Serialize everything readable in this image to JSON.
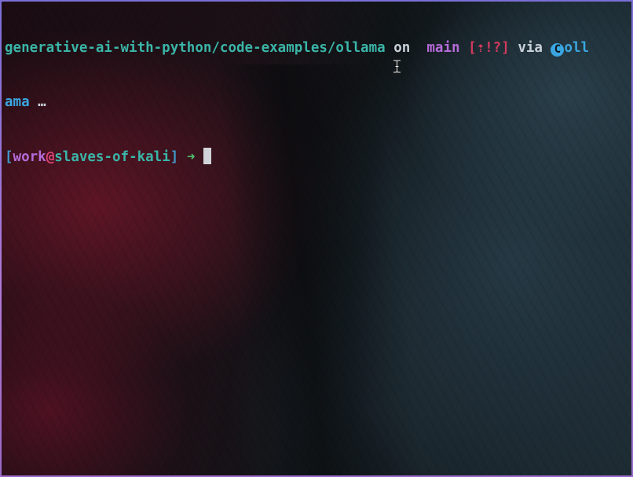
{
  "prompt_line1": {
    "path": "generative-ai-with-python/code-examples/ollama",
    "on": "on",
    "branch_icon": "",
    "branch": "main",
    "git_status": "[⇡!?]",
    "via": "via",
    "env_icon": "C",
    "env_name_a": "oll",
    "env_name_b": "ama",
    "ellipsis": "…"
  },
  "prompt_line2": {
    "open_bracket": "[",
    "user": "work",
    "at": "@",
    "host": "slaves-of-kali",
    "close_bracket": "]",
    "arrow": "➜"
  },
  "icons": {
    "branch": "git-branch-icon",
    "env": "ollama-env-icon",
    "cursor": "text-ibeam-cursor-icon"
  },
  "colors": {
    "path": "#3ab5a8",
    "branch": "#b56bd8",
    "git_status": "#d33a5e",
    "env": "#3aa6e0",
    "user": "#b56bd8",
    "at": "#e0487a",
    "host": "#3ab5a8",
    "arrow": "#4fc36f",
    "bracket": "#3f98c5",
    "window_border": "#9b6ac9"
  }
}
